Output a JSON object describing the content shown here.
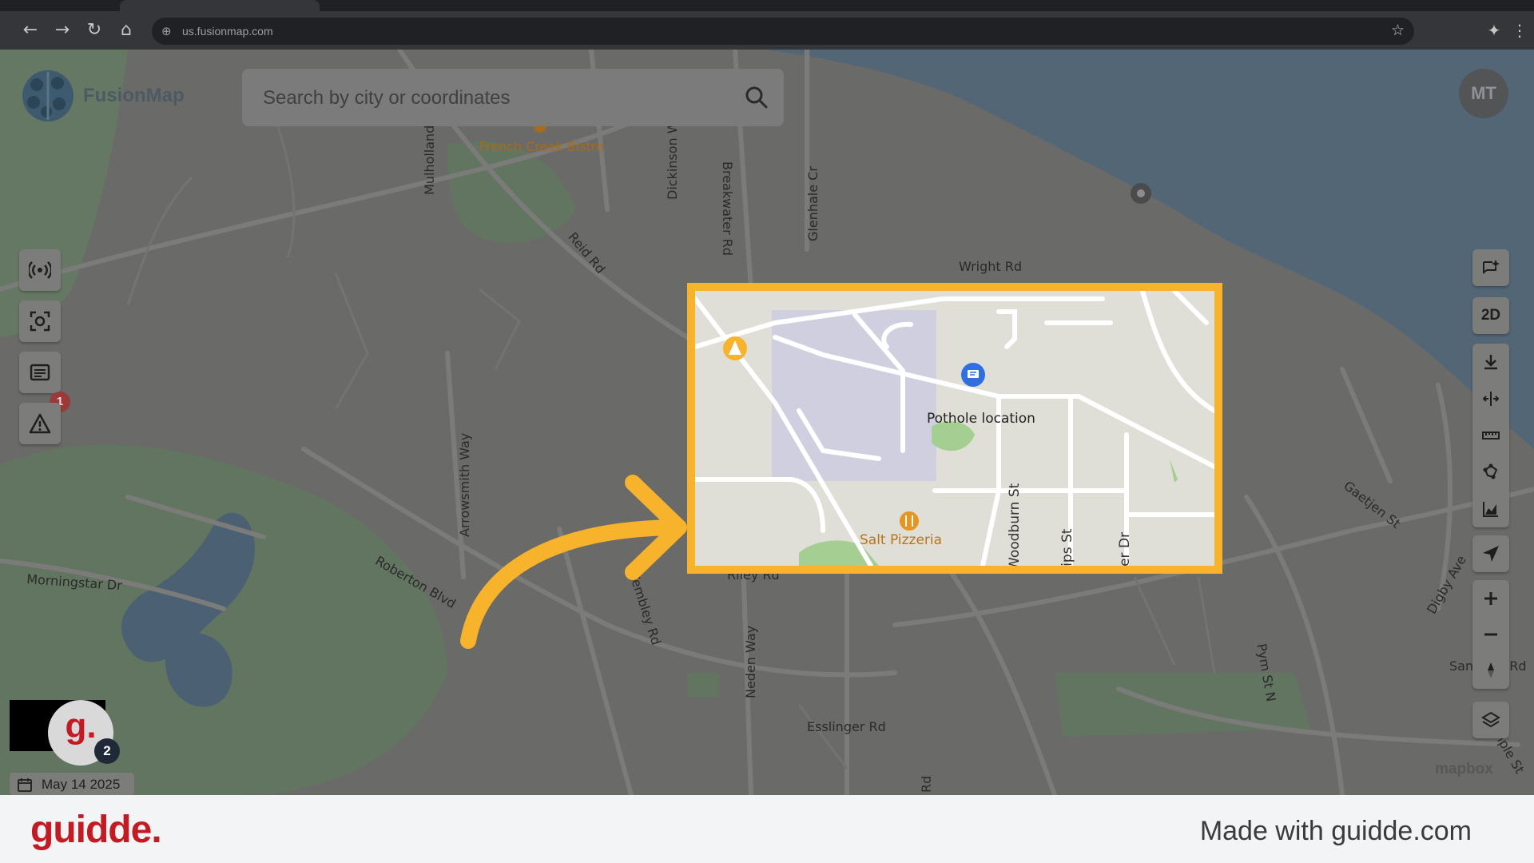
{
  "browser": {
    "url": "us.fusionmap.com",
    "back_icon": "arrow-left-icon",
    "forward_icon": "arrow-right-icon",
    "reload_icon": "reload-icon",
    "home_icon": "home-icon"
  },
  "app": {
    "logo_text": "FusionMap",
    "search_placeholder": "Search by city or coordinates",
    "user_initials": "MT",
    "messages_badge": "1",
    "date": "May 14 2025",
    "guidde_badge": "2",
    "guidde_letter": "g.",
    "attribution": "mapbox"
  },
  "map": {
    "pois": {
      "bistro": "French Creek Bistro",
      "pizzeria": "Salt Pizzeria",
      "pothole": "Pothole location"
    },
    "streets": {
      "mulholland": "Mulholland Dr",
      "dickinson": "Dickinson W",
      "breakwater": "Breakwater Rd",
      "glenhale": "Glenhale Cr",
      "reid": "Reid Rd",
      "wright": "Wright Rd",
      "arrowsmith": "Arrowsmith Way",
      "morningstar": "Morningstar Dr",
      "roberton": "Roberton Blvd",
      "wembley": "Wembley Rd",
      "riley": "Riley Rd",
      "neden": "Neden Way",
      "esslinger": "Esslinger Rd",
      "gaetjen": "Gaetjen St",
      "digby": "Digby Ave",
      "pym": "Pym St N",
      "sand": "Sand",
      "sand_suffix": "n Rd",
      "woodburn": "Woodburn St",
      "phillips": "Phillips St",
      "foster": "Foster Dr",
      "rd_bottom": "Rd",
      "temple": "emple St"
    }
  },
  "right_toolbar": {
    "mode_2d": "2D"
  },
  "footer": {
    "brand": "guidde.",
    "made_with": "Made with guidde.com"
  }
}
